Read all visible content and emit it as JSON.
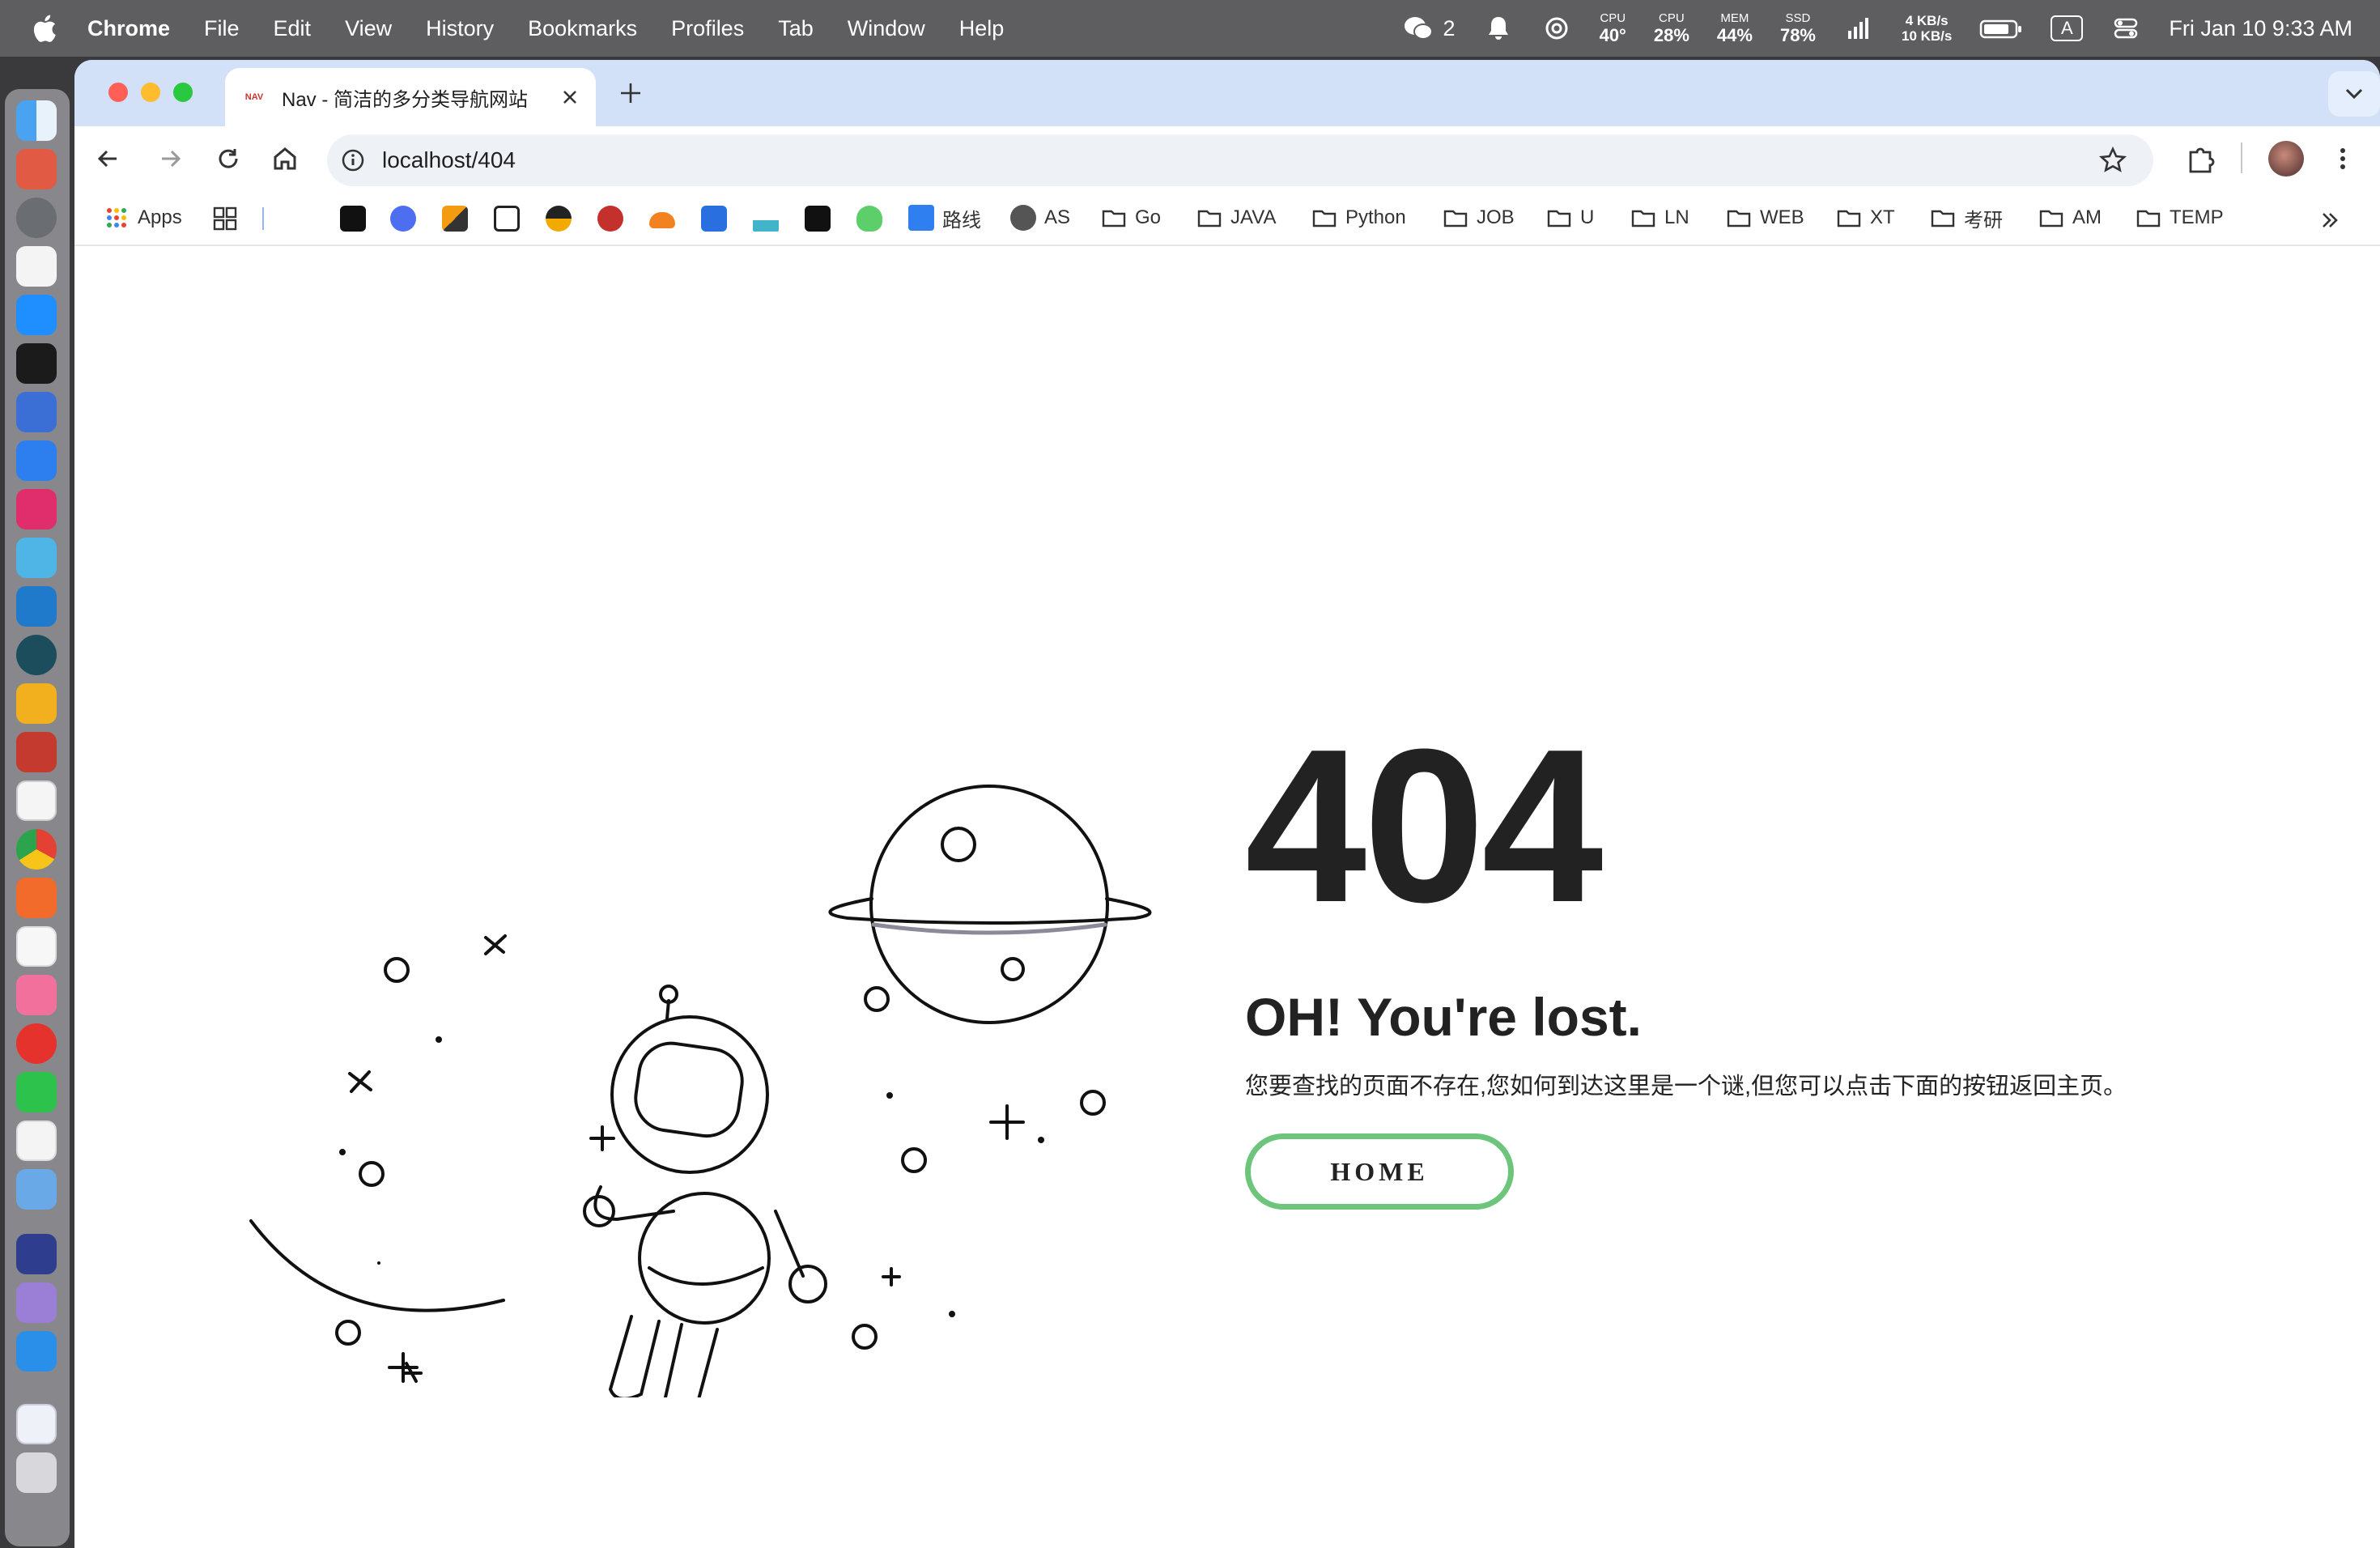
{
  "menubar": {
    "app": "Chrome",
    "items": [
      "File",
      "Edit",
      "View",
      "History",
      "Bookmarks",
      "Profiles",
      "Tab",
      "Window",
      "Help"
    ],
    "wechat_count": "2",
    "cpu_temp_label": "CPU",
    "cpu_temp_value": "40°",
    "cpu_label": "CPU",
    "cpu_value": "28%",
    "mem_label": "MEM",
    "mem_value": "44%",
    "ssd_label": "SSD",
    "ssd_value": "78%",
    "net_up": "4 KB/s",
    "net_down": "10 KB/s",
    "input_source": "A",
    "datetime": "Fri Jan 10  9:33 AM"
  },
  "browser": {
    "tab_favicon": "NAV",
    "tab_title": "Nav - 简洁的多分类导航网站",
    "url": "localhost/404",
    "bookmarks": {
      "apps": "Apps",
      "luxian": "路线",
      "as": "AS",
      "folders": [
        "Go",
        "JAVA",
        "Python",
        "JOB",
        "U",
        "LN",
        "WEB",
        "XT",
        "考研",
        "AM",
        "TEMP"
      ]
    }
  },
  "page": {
    "code": "404",
    "heading": "OH! You're lost.",
    "description": "您要查找的页面不存在,您如何到达这里是一个谜,但您可以点击下面的按钮返回主页。",
    "home_button": "HOME"
  },
  "colors": {
    "accent_green": "#6cc57b",
    "tabstrip": "#d3e1f8",
    "text_dark": "#222222"
  }
}
